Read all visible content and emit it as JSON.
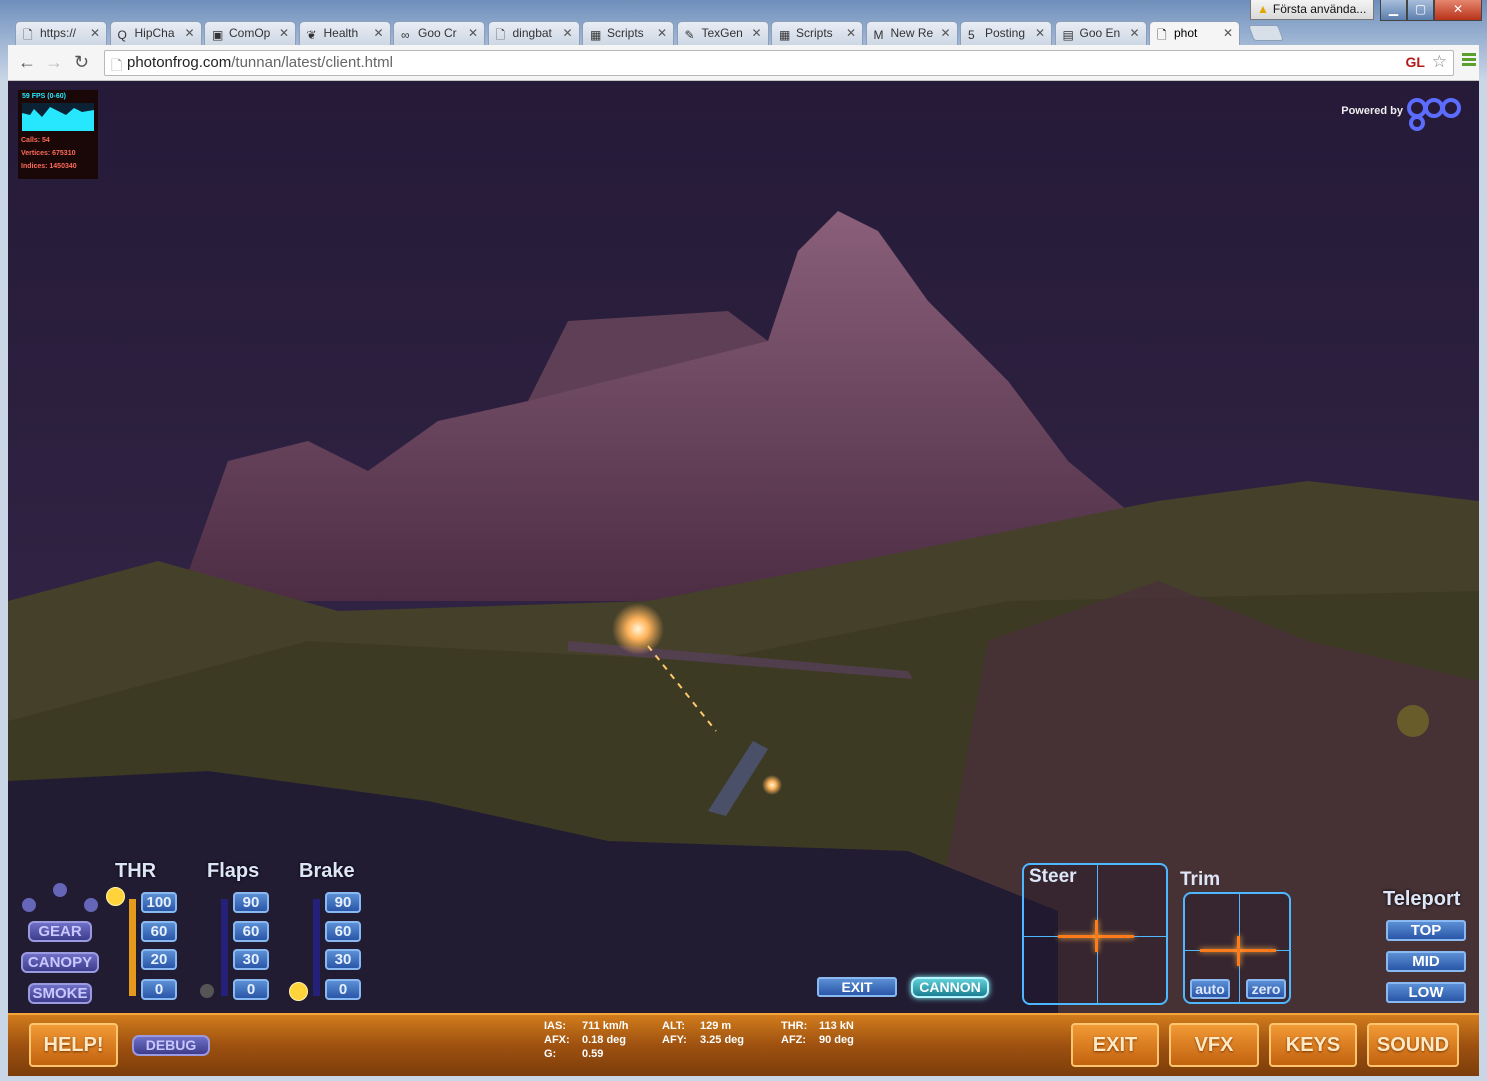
{
  "browser": {
    "warning_label": "Första använda...",
    "tabs": [
      {
        "label": "https://",
        "icon": "page-icon",
        "active": false
      },
      {
        "label": "HipCha",
        "icon": "chat-icon",
        "active": false
      },
      {
        "label": "ComOp",
        "icon": "com-icon",
        "active": false
      },
      {
        "label": "Health",
        "icon": "leaf-icon",
        "active": false
      },
      {
        "label": "Goo Cr",
        "icon": "infinity-icon",
        "active": false
      },
      {
        "label": "dingbat",
        "icon": "page-icon",
        "active": false
      },
      {
        "label": "Scripts",
        "icon": "sheet-icon",
        "active": false
      },
      {
        "label": "TexGen",
        "icon": "feather-icon",
        "active": false
      },
      {
        "label": "Scripts",
        "icon": "sheet-icon",
        "active": false
      },
      {
        "label": "New Re",
        "icon": "gmail-icon",
        "active": false
      },
      {
        "label": "Posting",
        "icon": "html5-icon",
        "active": false
      },
      {
        "label": "Goo En",
        "icon": "trello-icon",
        "active": false
      },
      {
        "label": "phot",
        "icon": "page-icon",
        "active": true
      }
    ],
    "url_domain": "photonfrog.com",
    "url_path": "/tunnan/latest/client.html",
    "gl_badge": "GL"
  },
  "stats": {
    "fps": "59 FPS (0-60)",
    "calls": "Calls: 54",
    "vertices": "Vertices: 675310",
    "indices": "Indices: 1450340"
  },
  "powered": {
    "text": "Powered by"
  },
  "hud": {
    "thr_label": "THR",
    "flaps_label": "Flaps",
    "brake_label": "Brake",
    "thr_buttons": [
      "100",
      "60",
      "20",
      "0"
    ],
    "flaps_buttons": [
      "90",
      "60",
      "30",
      "0"
    ],
    "brake_buttons": [
      "90",
      "60",
      "30",
      "0"
    ],
    "gear": "GEAR",
    "canopy": "CANOPY",
    "smoke": "SMOKE",
    "exit_small": "EXIT",
    "cannon": "CANNON",
    "steer_label": "Steer",
    "trim_label": "Trim",
    "trim_auto": "auto",
    "trim_zero": "zero",
    "teleport_label": "Teleport",
    "teleport": [
      "TOP",
      "MID",
      "LOW"
    ]
  },
  "bottom": {
    "help": "HELP!",
    "debug": "DEBUG",
    "exit": "EXIT",
    "vfx": "VFX",
    "keys": "KEYS",
    "sound": "SOUND"
  },
  "telemetry": {
    "ias_k": "IAS:",
    "ias_v": "711 km/h",
    "afx_k": "AFX:",
    "afx_v": "0.18 deg",
    "g_k": "G:",
    "g_v": "0.59",
    "alt_k": "ALT:",
    "alt_v": "129 m",
    "afy_k": "AFY:",
    "afy_v": "3.25 deg",
    "thr_k": "THR:",
    "thr_v": "113 kN",
    "afz_k": "AFZ:",
    "afz_v": "90 deg"
  },
  "colors": {
    "hud_blue": "#2a56a8",
    "hud_purple": "#3e3c8c",
    "bottom_orange": "#c2620f",
    "crosshair": "#ff7a1a"
  }
}
